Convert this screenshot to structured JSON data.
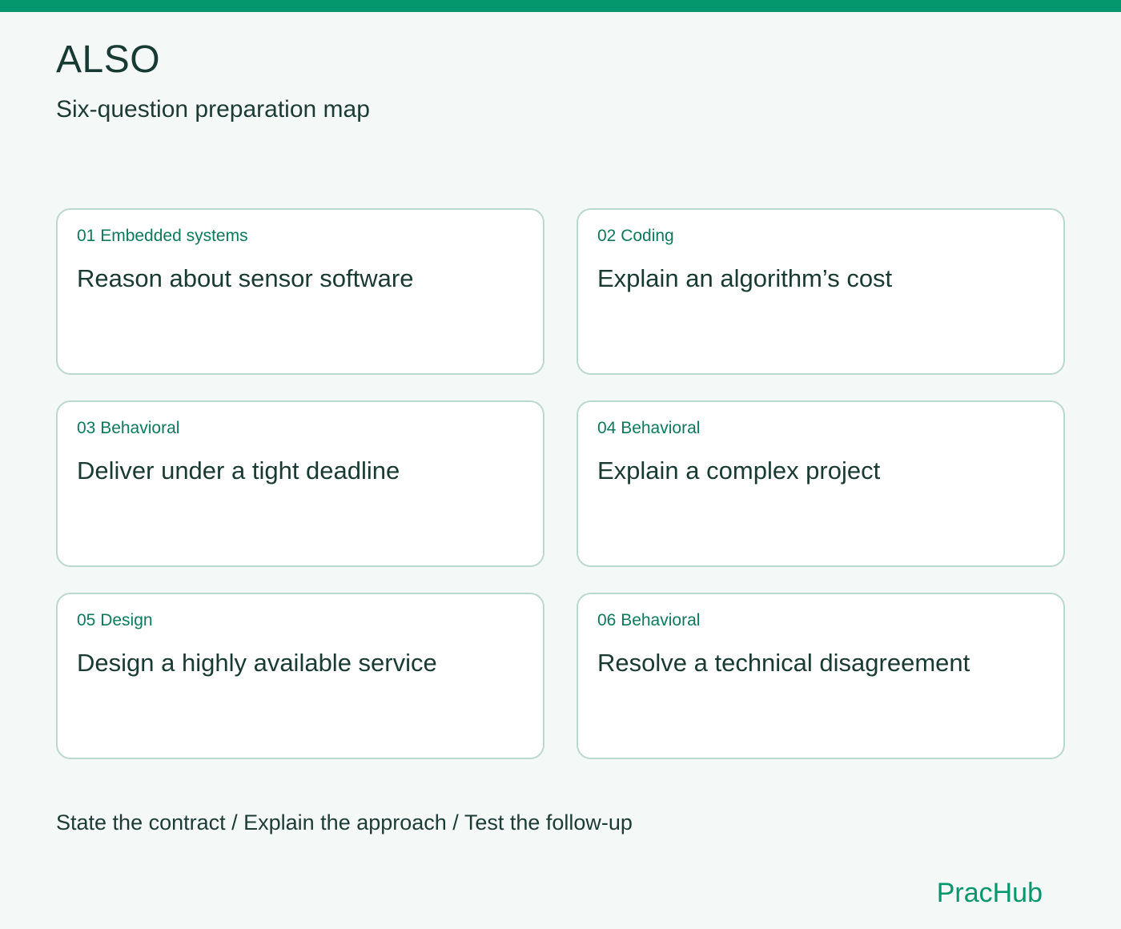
{
  "colors": {
    "accent": "#04966d",
    "background": "#f4f8f7",
    "card_border": "#b9d9d0",
    "tag_text": "#0b7a5c",
    "heading_text": "#173a33"
  },
  "header": {
    "title": "ALSO",
    "subtitle": "Six-question preparation map"
  },
  "cards": [
    {
      "tag": "01 Embedded systems",
      "title": "Reason about sensor software"
    },
    {
      "tag": "02 Coding",
      "title": "Explain an algorithm’s cost"
    },
    {
      "tag": "03 Behavioral",
      "title": "Deliver under a tight deadline"
    },
    {
      "tag": "04 Behavioral",
      "title": "Explain a complex project"
    },
    {
      "tag": "05 Design",
      "title": "Design a highly available service"
    },
    {
      "tag": "06 Behavioral",
      "title": "Resolve a technical disagreement"
    }
  ],
  "footer": {
    "steps": "State the contract / Explain the approach / Test the follow-up",
    "brand": "PracHub"
  }
}
